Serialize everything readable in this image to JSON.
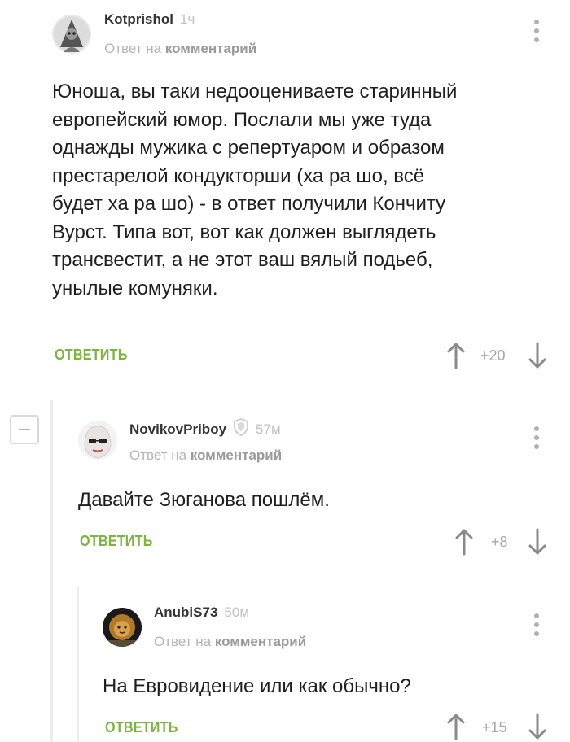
{
  "comments": [
    {
      "author": "Kotprishol",
      "time": "1ч",
      "reply_prefix": "Ответ на",
      "reply_target": "комментарий",
      "text_lines": [
        "Юноша, вы таки недооцениваете старинный",
        "европейский юмор. Послали мы уже туда",
        "однажды мужика с репертуаром и образом",
        "престарелой кондукторши (ха ра шо, всё",
        "будет ха ра шо) - в ответ получили  Кончиту",
        "Вурст. Типа вот, вот как должен выглядеть",
        "трансвестит, а не этот ваш вялый подьеб,",
        "унылые комуняки."
      ],
      "reply_label": "ОТВЕТИТЬ",
      "rating": "+20"
    },
    {
      "author": "NovikovPriboy",
      "time": "57м",
      "reply_prefix": "Ответ на",
      "reply_target": "комментарий",
      "text_lines": [
        "Давайте Зюганова пошлём."
      ],
      "reply_label": "ОТВЕТИТЬ",
      "rating": "+8"
    },
    {
      "author": "AnubiS73",
      "time": "50м",
      "reply_prefix": "Ответ на",
      "reply_target": "комментарий",
      "text_lines": [
        "На Евровидение или как обычно?"
      ],
      "reply_label": "ОТВЕТИТЬ",
      "rating": "+15"
    }
  ],
  "icons": {
    "upvote": "arrow-up-icon",
    "downvote": "arrow-down-icon",
    "menu": "more-vertical-icon",
    "collapse": "minus-icon",
    "badge": "shield-icon"
  },
  "colors": {
    "reply_green": "#7cb342",
    "muted": "#b5b5b5"
  }
}
